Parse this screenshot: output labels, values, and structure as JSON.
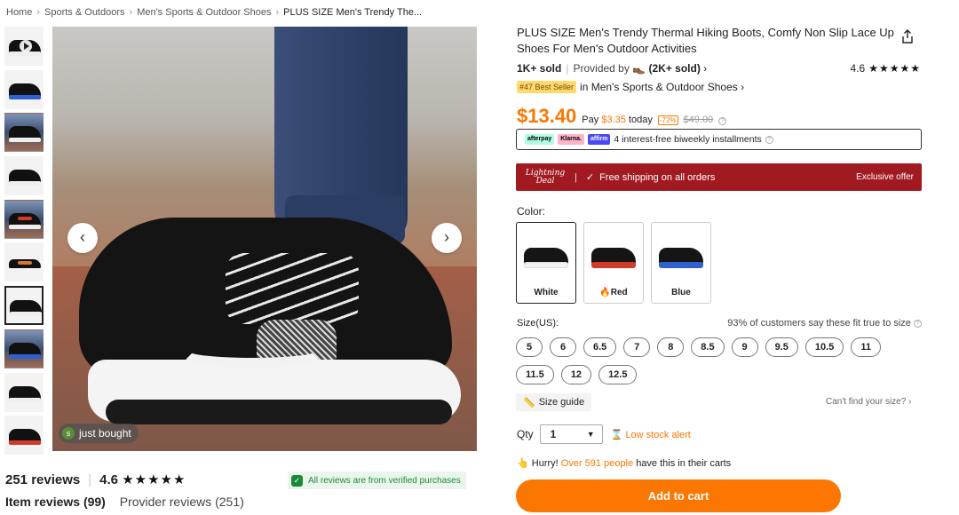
{
  "breadcrumb": {
    "items": [
      "Home",
      "Sports & Outdoors",
      "Men's Sports & Outdoor Shoes",
      "PLUS SIZE Men's Trendy The..."
    ],
    "separator": "›"
  },
  "gallery": {
    "prev_glyph": "‹",
    "next_glyph": "›",
    "just_bought": "just bought",
    "avatar_letter": "s"
  },
  "reviews": {
    "count_label": "251 reviews",
    "rating": "4.6",
    "stars": "★★★★★",
    "verified_text": "All reviews are from verified purchases",
    "tab_item": "Item reviews (99)",
    "tab_provider": "Provider reviews (251)"
  },
  "product": {
    "title": "PLUS SIZE Men's Trendy Thermal Hiking Boots, Comfy Non Slip Lace Up Shoes For Men's Outdoor Activities",
    "sold": "1K+ sold",
    "provided_by": "Provided by",
    "provider_sold": "(2K+ sold)",
    "rating": "4.6",
    "stars": "★★★★★",
    "best_badge": "#47 Best Seller",
    "best_category": "in Men's Sports & Outdoor Shoes ›",
    "price": "$13.40",
    "pay_prefix": "Pay",
    "pay_amount": "$3.35",
    "pay_suffix": "today",
    "discount": "-72%",
    "old_price": "$49.00",
    "afterpay": "afterpay",
    "klarna": "Klarna.",
    "affirm": "affirm",
    "installments": "4 interest-free biweekly installments"
  },
  "deal": {
    "logo_line1": "Lightning",
    "logo_line2": "Deal",
    "shipping": "Free shipping on all orders",
    "exclusive": "Exclusive offer"
  },
  "color": {
    "label": "Color:",
    "options": [
      {
        "name": "White",
        "accent": "#f2f2f2"
      },
      {
        "name": "Red",
        "accent": "#d23a2a",
        "prefix": "🔥"
      },
      {
        "name": "Blue",
        "accent": "#2f5fd0"
      }
    ]
  },
  "size": {
    "label": "Size(US):",
    "fit_note": "93% of customers say these fit true to size",
    "options": [
      "5",
      "6",
      "6.5",
      "7",
      "8",
      "8.5",
      "9",
      "9.5",
      "10.5",
      "11",
      "11.5",
      "12",
      "12.5"
    ],
    "guide": "Size guide",
    "cant_find": "Can't find your size? ›"
  },
  "purchase": {
    "qty_label": "Qty",
    "qty_value": "1",
    "low_stock": "Low stock alert",
    "hurry_prefix": "Hurry!",
    "hurry_count": "Over 591 people",
    "hurry_suffix": "have this in their carts",
    "add_to_cart": "Add to cart"
  },
  "colors": {
    "brand_orange": "#fb7701",
    "deal_red": "#a11a21",
    "verified_green": "#1a8a3a"
  }
}
